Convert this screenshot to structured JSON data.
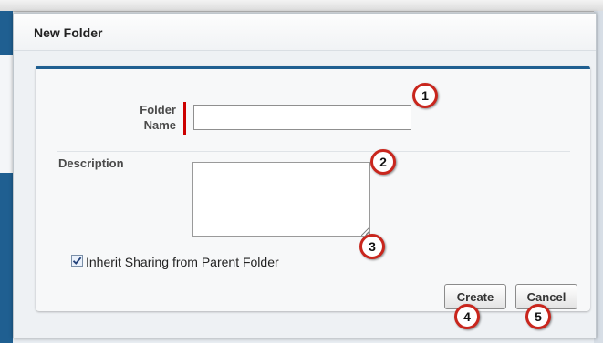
{
  "dialog": {
    "title": "New Folder"
  },
  "form": {
    "folder_name_label": "Folder Name",
    "folder_name_value": "",
    "description_label": "Description",
    "description_value": "",
    "inherit_sharing_label": "Inherit Sharing from Parent Folder",
    "inherit_sharing_checked": true
  },
  "buttons": {
    "create": "Create",
    "cancel": "Cancel"
  },
  "callouts": [
    "1",
    "2",
    "3",
    "4",
    "5"
  ],
  "colors": {
    "accent": "#1f5f91",
    "required": "#cc0000",
    "callout_border": "#c9261d"
  },
  "icons": {
    "checkbox": "check-icon",
    "textarea_grip": "resize-grip-icon"
  }
}
